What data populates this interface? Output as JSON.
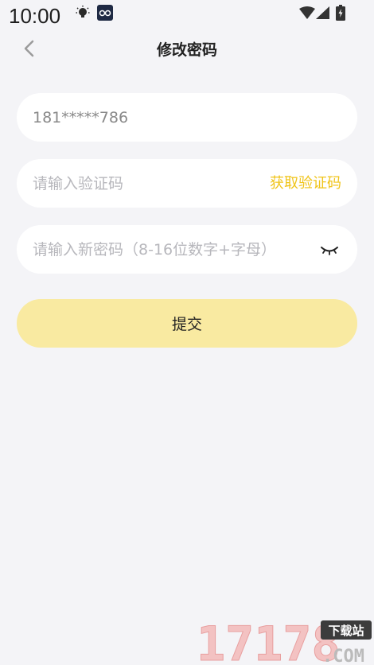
{
  "status_bar": {
    "time": "10:00",
    "icons": [
      "bulb-icon",
      "app-notification-icon",
      "wifi-icon",
      "signal-icon",
      "battery-icon"
    ]
  },
  "header": {
    "back_icon": "chevron-left-icon",
    "title": "修改密码"
  },
  "form": {
    "phone": {
      "value": "181*****786"
    },
    "code": {
      "placeholder": "请输入验证码",
      "get_code_label": "获取验证码"
    },
    "password": {
      "placeholder": "请输入新密码（8-16位数字+字母）",
      "toggle_icon": "eye-closed-icon"
    },
    "submit_label": "提交"
  },
  "watermark": {
    "number": "17178",
    "domain": ".COM",
    "site": "下载站"
  },
  "colors": {
    "background": "#f4f4f7",
    "field_bg": "#ffffff",
    "accent": "#f0c419",
    "button": "#f9eaa1"
  }
}
